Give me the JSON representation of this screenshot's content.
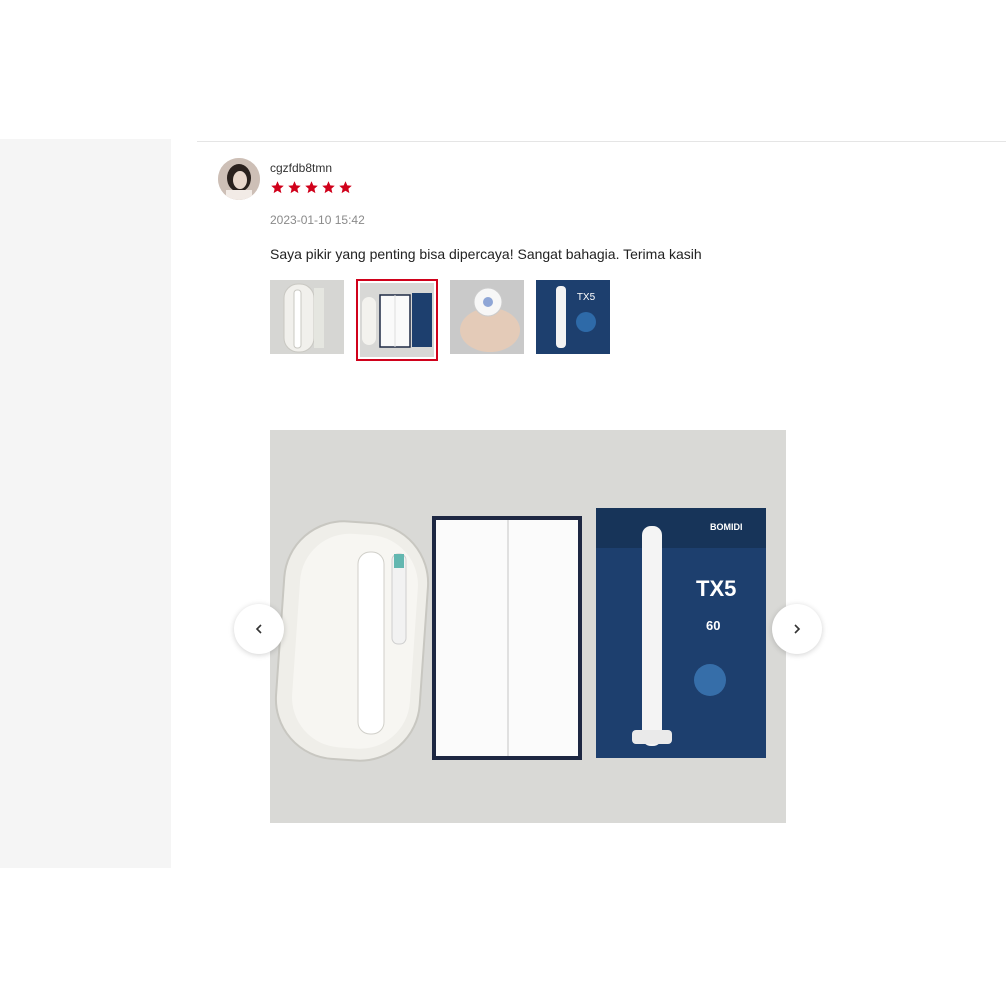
{
  "review": {
    "username": "cgzfdb8tmn",
    "rating": 5,
    "rating_max": 5,
    "star_color": "#d0011b",
    "timestamp": "2023-01-10 15:42",
    "comment": "Saya pikir yang penting bisa dipercaya! Sangat bahagia. Terima kasih",
    "thumbnails": [
      {
        "name": "toothbrush-case-photo",
        "selected": false
      },
      {
        "name": "boxes-flatlay-photo",
        "selected": true
      },
      {
        "name": "hand-holding-device-photo",
        "selected": false
      },
      {
        "name": "product-box-photo",
        "selected": false
      }
    ]
  },
  "viewer": {
    "box_brand": "BOMIDI",
    "box_model": "TX5",
    "box_badge": "60",
    "prev_icon": "chevron-left-icon",
    "next_icon": "chevron-right-icon"
  },
  "colors": {
    "accent": "#d0011b",
    "box_blue": "#1d3f6e"
  }
}
